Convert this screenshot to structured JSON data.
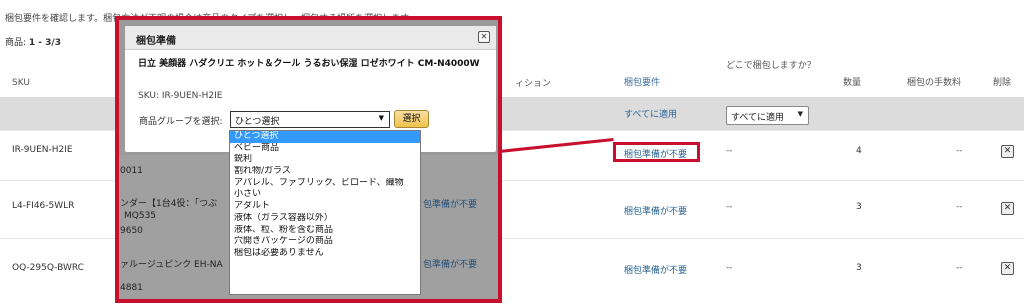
{
  "page": {
    "intro": "梱包要件を確認します。梱包方法が不明の場合は商品のタイプを選択し、梱包する場所を選択します。",
    "count_label": "商品: ",
    "count_value": "1 - 3/3"
  },
  "table": {
    "headers": {
      "sku": "SKU",
      "condition": "ィション",
      "requirement": "梱包要件",
      "where": "どこで梱包しますか？",
      "qty": "数量",
      "fee": "梱包の手数料",
      "delete": "削除"
    },
    "apply_all_link": "すべてに適用",
    "apply_all_select": "すべてに適用",
    "rows": [
      {
        "sku": "IR-9UEN-H2IE",
        "requirement": "梱包準備が不要",
        "where": "--",
        "qty": "4",
        "fee": "--",
        "delete": "✕"
      },
      {
        "sku": "L4-FI46-5WLR",
        "requirement": "梱包準備が不要",
        "where": "--",
        "qty": "3",
        "fee": "--",
        "delete": "✕"
      },
      {
        "sku": "OQ-295Q-BWRC",
        "requirement": "梱包準備が不要",
        "where": "--",
        "qty": "3",
        "fee": "--",
        "delete": "✕"
      }
    ]
  },
  "behind": {
    "row1_id": "0011",
    "row2_title": "ンダー【1台4役：「つぶ",
    "row2_model": "MQ535",
    "row2_id": "9650",
    "row2_req": "包準備が不要",
    "row3_title": "ァルージュピンク EH-NA",
    "row3_id": "4881",
    "row3_req": "包準備が不要"
  },
  "dialog": {
    "title": "梱包準備",
    "close": "✕",
    "product_name": "日立 美顔器 ハダクリエ ホット＆クール うるおい保湿 ロゼホワイト CM-N4000W",
    "sku_line": "SKU: IR-9UEN-H2IE",
    "group_label": "商品グループを選択:",
    "selected": "ひとつ選択",
    "go_button": "選択",
    "options": [
      "ひとつ選択",
      "ベビー商品",
      "鋭利",
      "割れ物/ガラス",
      "アパレル、ファブリック、ビロード、織物",
      "小さい",
      "アダルト",
      "液体（ガラス容器以外）",
      "液体、粒、粉を含む商品",
      "穴開きパッケージの商品",
      "梱包は必要ありません"
    ]
  },
  "colors": {
    "highlight": "#c8102e",
    "link": "#2a6496",
    "selected_option": "#3399ff",
    "button": "#f0c14b"
  }
}
